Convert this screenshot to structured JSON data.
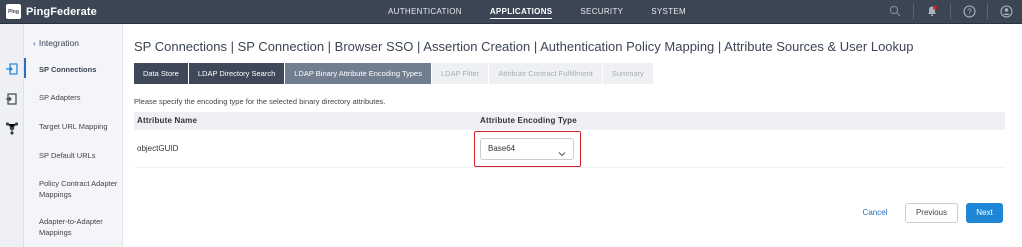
{
  "app": {
    "logo_badge": "Ping",
    "brand": "PingFederate"
  },
  "topnav": {
    "items": [
      {
        "label": "AUTHENTICATION",
        "active": false
      },
      {
        "label": "APPLICATIONS",
        "active": true
      },
      {
        "label": "SECURITY",
        "active": false
      },
      {
        "label": "SYSTEM",
        "active": false
      }
    ],
    "icons": [
      "search-icon",
      "notifications-icon",
      "help-icon",
      "user-icon"
    ]
  },
  "rail": {
    "icons": [
      "applications-icon",
      "document-icon",
      "network-icon"
    ]
  },
  "sidebar": {
    "back_label": "Integration",
    "items": [
      {
        "label": "SP Connections",
        "active": true
      },
      {
        "label": "SP Adapters",
        "active": false
      },
      {
        "label": "Target URL Mapping",
        "active": false
      },
      {
        "label": "SP Default URLs",
        "active": false
      },
      {
        "label": "Policy Contract Adapter Mappings",
        "active": false
      },
      {
        "label": "Adapter-to-Adapter Mappings",
        "active": false
      }
    ]
  },
  "breadcrumb": "SP Connections | SP Connection | Browser SSO | Assertion Creation | Authentication Policy Mapping | Attribute Sources & User Lookup",
  "tabs": [
    {
      "label": "Data Store",
      "state": "done"
    },
    {
      "label": "LDAP Directory Search",
      "state": "done"
    },
    {
      "label": "LDAP Binary Attribute Encoding Types",
      "state": "current"
    },
    {
      "label": "LDAP Filter",
      "state": "pending"
    },
    {
      "label": "Attribute Contract Fulfillment",
      "state": "pending"
    },
    {
      "label": "Summary",
      "state": "pending"
    }
  ],
  "instruction": "Please specify the encoding type for the selected binary directory attributes.",
  "table": {
    "headers": [
      "Attribute Name",
      "Attribute Encoding Type"
    ],
    "rows": [
      {
        "attribute_name": "objectGUID",
        "encoding_type": "Base64"
      }
    ]
  },
  "colors": {
    "topbar": "#3c4553",
    "accent": "#1f86d6",
    "highlight": "#d0242a"
  },
  "buttons": {
    "cancel": "Cancel",
    "previous": "Previous",
    "next": "Next"
  }
}
